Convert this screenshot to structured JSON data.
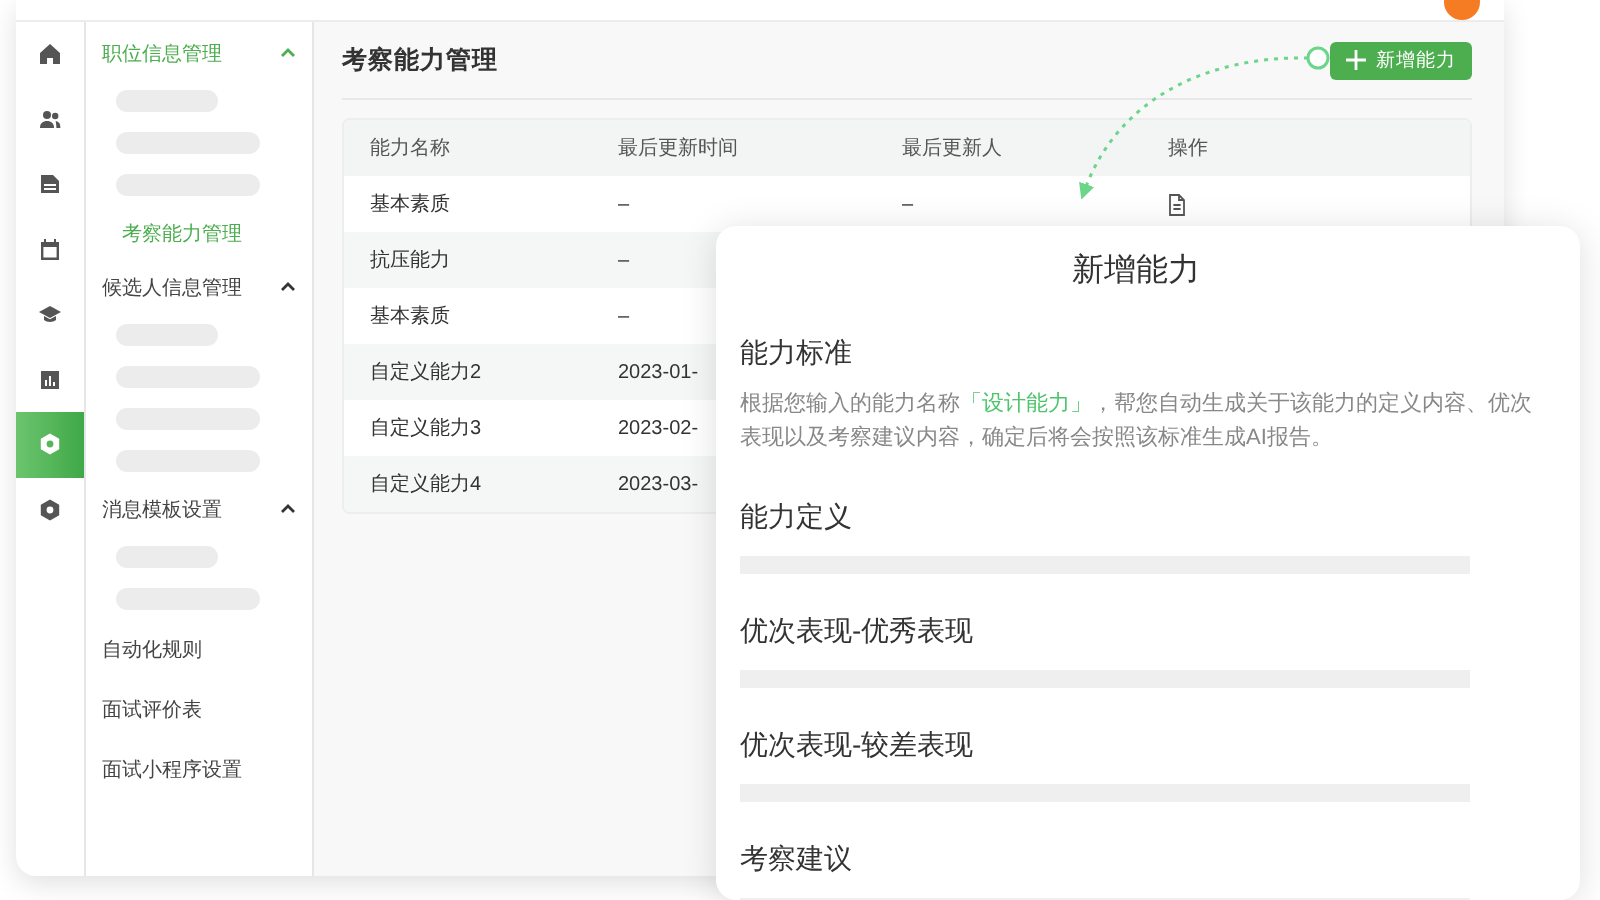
{
  "rail": [
    {
      "selected": false
    },
    {
      "selected": false
    },
    {
      "selected": false
    },
    {
      "selected": false
    },
    {
      "selected": false
    },
    {
      "selected": false
    },
    {
      "selected": true
    },
    {
      "selected": false
    }
  ],
  "sidebar": {
    "groups": [
      {
        "label": "职位信息管理",
        "selected": true,
        "expanded": true,
        "children": [
          {
            "kind": "short"
          },
          {
            "kind": "long"
          },
          {
            "kind": "long"
          },
          {
            "kind": "item",
            "label": "考察能力管理",
            "selected": true
          }
        ]
      },
      {
        "label": "候选人信息管理",
        "selected": false,
        "expanded": true,
        "children": [
          {
            "kind": "short"
          },
          {
            "kind": "long"
          },
          {
            "kind": "long"
          },
          {
            "kind": "long"
          }
        ]
      },
      {
        "label": "消息模板设置",
        "selected": false,
        "expanded": true,
        "children": [
          {
            "kind": "short"
          },
          {
            "kind": "long"
          }
        ]
      }
    ],
    "items": [
      {
        "label": "自动化规则",
        "selected": false
      },
      {
        "label": "面试评价表",
        "selected": false
      },
      {
        "label": "面试小程序设置",
        "selected": false
      }
    ]
  },
  "main": {
    "title": "考察能力管理",
    "add_button": {
      "label": "新增能力"
    },
    "table": {
      "columns": [
        "能力名称",
        "最后更新时间",
        "最后更新人",
        "操作"
      ],
      "rows": [
        {
          "cells": [
            "基本素质",
            "–",
            "–"
          ]
        },
        {
          "cells": [
            "抗压能力",
            "–"
          ]
        },
        {
          "cells": [
            "基本素质",
            "–"
          ]
        },
        {
          "cells": [
            "自定义能力2",
            "2023-01-"
          ]
        },
        {
          "cells": [
            "自定义能力3",
            "2023-02-"
          ]
        },
        {
          "cells": [
            "自定义能力4",
            "2023-03-"
          ]
        }
      ]
    }
  },
  "modal": {
    "title": "新增能力",
    "sections": [
      {
        "kind": "text",
        "heading": "能力标准",
        "text": "根据您输入的能力名称**「设计能力」**，帮您自动生成关于该能力的定义内容、优次表现以及考察建议内容，确定后将会按照该标准生成AI报告。"
      },
      {
        "kind": "field",
        "heading": "能力定义"
      },
      {
        "kind": "field",
        "heading": "优次表现-优秀表现"
      },
      {
        "kind": "field",
        "heading": "优次表现-较差表现"
      },
      {
        "kind": "field",
        "heading": "考察建议"
      }
    ]
  }
}
